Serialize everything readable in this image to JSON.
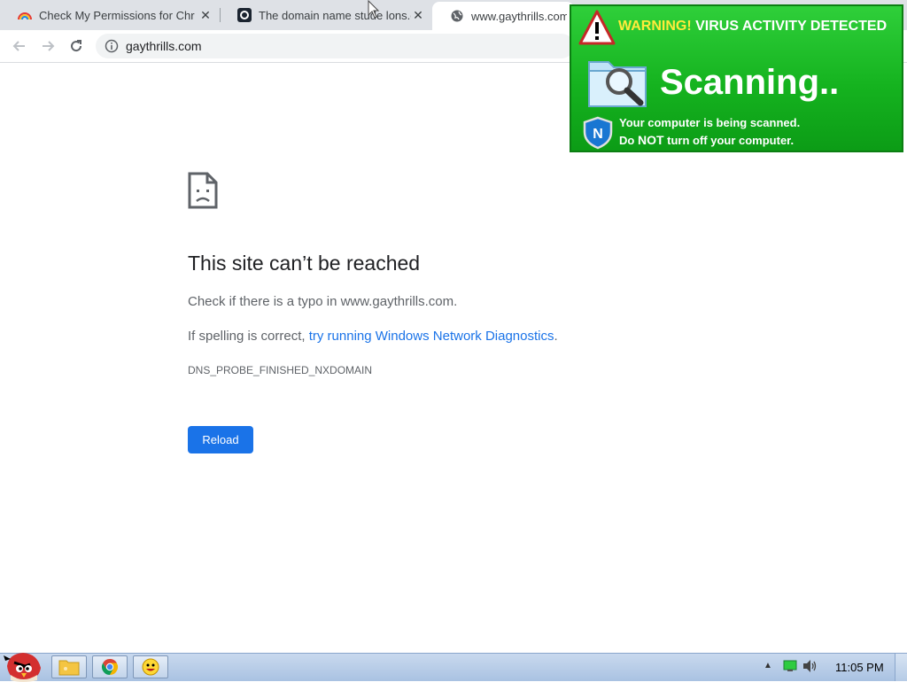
{
  "tabs": [
    {
      "title": "Check My Permissions for Chr",
      "favicon": "rainbow-icon"
    },
    {
      "title": "The domain name stude lons.c",
      "favicon": "site-logo-icon"
    },
    {
      "title": "www.gaythrills.com",
      "favicon": "globe-icon",
      "active": true
    }
  ],
  "toolbar": {
    "url": "gaythrills.com"
  },
  "error": {
    "title": "This site can’t be reached",
    "line1": "Check if there is a typo in www.gaythrills.com.",
    "line2_prefix": "If spelling is correct, ",
    "line2_link": "try running Windows Network Diagnostics",
    "line2_suffix": ".",
    "code": "DNS_PROBE_FINISHED_NXDOMAIN",
    "reload_label": "Reload"
  },
  "popup": {
    "warning_word": "WARNING!",
    "warning_rest": "VIRUS ACTIVITY DETECTED",
    "scanning": "Scanning..",
    "msg1": "Your computer is being scanned.",
    "msg2_pre": "Do ",
    "msg2_bold": "NOT",
    "msg2_post": " turn off your computer.",
    "shield_letter": "N"
  },
  "taskbar": {
    "clock": "11:05 PM",
    "apps": [
      "angry-bird-start-icon",
      "folder-icon",
      "chrome-icon",
      "smiley-icon"
    ]
  },
  "colors": {
    "accent": "#1a73e8",
    "popup_green": "#15b31f",
    "warning_yellow": "#ffeb3b"
  }
}
